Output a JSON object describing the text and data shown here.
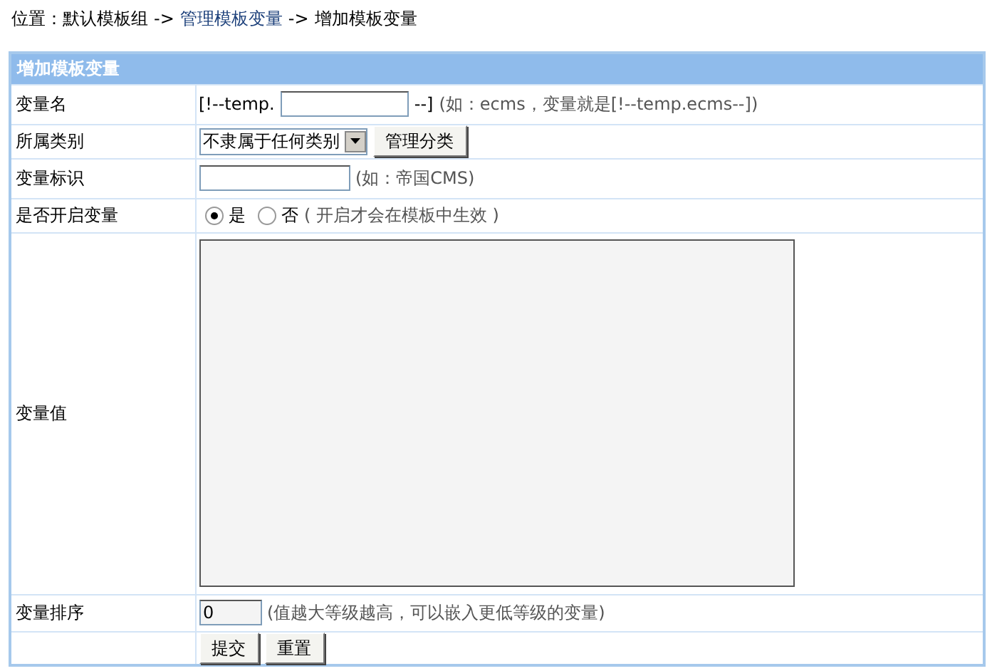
{
  "breadcrumb": {
    "label": "位置：",
    "items": [
      {
        "text": "默认模板组",
        "link": false
      },
      {
        "text": "管理模板变量",
        "link": true
      },
      {
        "text": "增加模板变量",
        "link": false
      }
    ],
    "separator": "->"
  },
  "form": {
    "title": "增加模板变量",
    "rows": [
      {
        "kind": "name",
        "label": "变量名",
        "prefix": "[!--temp.",
        "value": "",
        "suffix": "--]",
        "hint": "(如：ecms，变量就是[!--temp.ecms--])"
      },
      {
        "kind": "select",
        "label": "所属类别",
        "value": "不隶属于任何类别",
        "button": "管理分类"
      },
      {
        "kind": "text",
        "label": "变量标识",
        "value": "",
        "hint": "(如：帝国CMS)"
      },
      {
        "kind": "radio",
        "label": "是否开启变量",
        "options": [
          {
            "text": "是",
            "selected": true
          },
          {
            "text": "否",
            "selected": false
          }
        ],
        "hint": "( 开启才会在模板中生效 )"
      },
      {
        "kind": "textarea",
        "label": "变量值",
        "value": ""
      },
      {
        "kind": "text-short",
        "label": "变量排序",
        "value": "0",
        "hint": "(值越大等级越高，可以嵌入更低等级的变量)"
      },
      {
        "kind": "buttons",
        "label": "",
        "buttons": [
          "提交",
          "重置"
        ]
      }
    ]
  }
}
